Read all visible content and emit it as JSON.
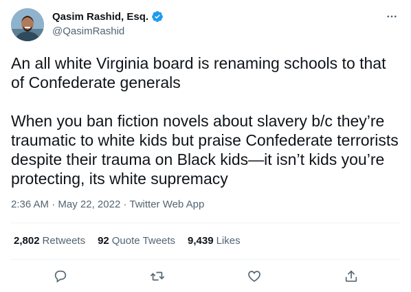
{
  "author": {
    "display_name": "Qasim Rashid, Esq.",
    "handle": "@QasimRashid",
    "verified": true
  },
  "tweet": {
    "paragraph_1": "An all white Virginia board is renaming schools to that of Confederate generals",
    "paragraph_2": "When you ban fiction novels about slavery b/c they’re traumatic to white kids but praise Confederate terrorists despite their trauma on Black kids—it isn’t kids you’re protecting, its white supremacy"
  },
  "meta": {
    "time": "2:36 AM",
    "separator": " · ",
    "date": "May 22, 2022",
    "source": "Twitter Web App"
  },
  "stats": {
    "retweets_count": "2,802",
    "retweets_label": "Retweets",
    "quotes_count": "92",
    "quotes_label": "Quote Tweets",
    "likes_count": "9,439",
    "likes_label": "Likes"
  },
  "icons": {
    "reply": "reply-icon",
    "retweet": "retweet-icon",
    "like": "like-icon",
    "share": "share-icon",
    "more": "more-icon",
    "verified": "verified-badge-icon"
  },
  "colors": {
    "text": "#0f1419",
    "secondary": "#536471",
    "verified_blue": "#1d9bf0",
    "divider": "#eff3f4"
  }
}
